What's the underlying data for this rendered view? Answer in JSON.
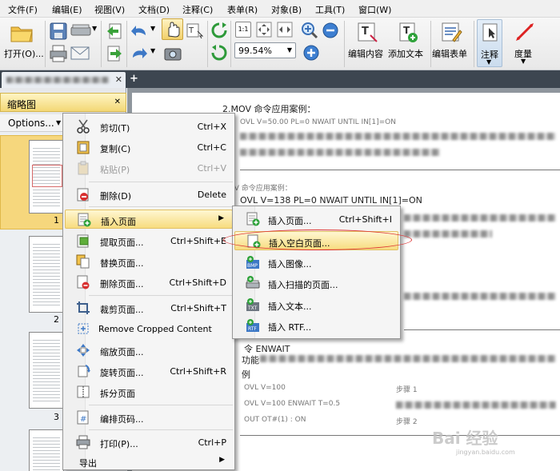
{
  "menubar": {
    "items": [
      "文件(F)",
      "编辑(E)",
      "视图(V)",
      "文档(D)",
      "注释(C)",
      "表单(R)",
      "对象(B)",
      "工具(T)",
      "窗口(W)"
    ]
  },
  "toolbar": {
    "open_label": "打开(O)...",
    "zoom_value": "99.54%",
    "edit_content_label": "编辑内容",
    "add_text_label": "添加文本",
    "edit_form_label": "编辑表单",
    "annotation_label": "注释",
    "measure_label": "度量"
  },
  "left_panel": {
    "title": "缩略图",
    "options_label": "Options...",
    "page_numbers": [
      "1",
      "2",
      "3"
    ]
  },
  "context_menu": {
    "items": [
      {
        "label": "剪切(T)",
        "shortcut": "Ctrl+X",
        "icon": "scissors-icon"
      },
      {
        "label": "复制(C)",
        "shortcut": "Ctrl+C",
        "icon": "copy-icon"
      },
      {
        "label": "粘贴(P)",
        "shortcut": "Ctrl+V",
        "icon": "paste-icon",
        "disabled": true
      },
      {
        "label": "删除(D)",
        "shortcut": "Delete",
        "icon": "delete-icon"
      },
      {
        "label": "插入页面",
        "shortcut": "",
        "icon": "insert-page-icon",
        "submenu": true
      },
      {
        "label": "提取页面...",
        "shortcut": "Ctrl+Shift+E",
        "icon": "extract-page-icon"
      },
      {
        "label": "替换页面...",
        "shortcut": "",
        "icon": "replace-page-icon"
      },
      {
        "label": "删除页面...",
        "shortcut": "Ctrl+Shift+D",
        "icon": "delete-page-icon"
      },
      {
        "label": "裁剪页面...",
        "shortcut": "Ctrl+Shift+T",
        "icon": "crop-page-icon"
      },
      {
        "label": "Remove Cropped Content",
        "shortcut": "",
        "icon": "remove-crop-icon"
      },
      {
        "label": "缩放页面...",
        "shortcut": "",
        "icon": "resize-page-icon"
      },
      {
        "label": "旋转页面...",
        "shortcut": "Ctrl+Shift+R",
        "icon": "rotate-page-icon"
      },
      {
        "label": "拆分页面",
        "shortcut": "",
        "icon": "split-page-icon"
      },
      {
        "label": "编排页码...",
        "shortcut": "",
        "icon": "page-number-icon"
      },
      {
        "label": "打印(P)...",
        "shortcut": "Ctrl+P",
        "icon": "print-icon"
      },
      {
        "label": "导出",
        "shortcut": "",
        "icon": "export-icon",
        "submenu": true
      }
    ]
  },
  "submenu": {
    "items": [
      {
        "label": "插入页面...",
        "shortcut": "Ctrl+Shift+I",
        "icon": "insert-page-file-icon"
      },
      {
        "label": "插入空白页面...",
        "shortcut": "",
        "icon": "insert-blank-page-icon",
        "highlighted": true
      },
      {
        "label": "插入图像...",
        "shortcut": "",
        "icon": "insert-image-icon"
      },
      {
        "label": "插入扫描的页面...",
        "shortcut": "",
        "icon": "insert-scan-icon"
      },
      {
        "label": "插入文本...",
        "shortcut": "",
        "icon": "insert-text-icon"
      },
      {
        "label": "插入 RTF...",
        "shortcut": "",
        "icon": "insert-rtf-icon"
      }
    ]
  },
  "document": {
    "heading1": "2.MOV 命令应用案例：",
    "heading2": "MOV 命令应用案例：",
    "row_v": "OVL  V=138  PL=0  NWAIT  UNTIL  IN[1]=ON",
    "row_v1": "OVL  V=50.00  PL=0  NWAIT  UNTIL  IN[1]=ON",
    "label_func": "功能",
    "nwait": "令 ENWAIT",
    "label_example": "例",
    "row_a": "OVL V=100",
    "row_b": "OVL V=100 ENWAIT T=0.5",
    "row_c": "OUT OT#(1) : ON",
    "step1": "步骤 1",
    "step2": "步骤 2"
  },
  "watermark": {
    "brand": "Bai 经验",
    "domain": "jingyan.baidu.com"
  },
  "colors": {
    "tab_bar": "#3d4650",
    "highlight": "#f7dc7f",
    "annotation_ellipse": "#dd3333"
  }
}
